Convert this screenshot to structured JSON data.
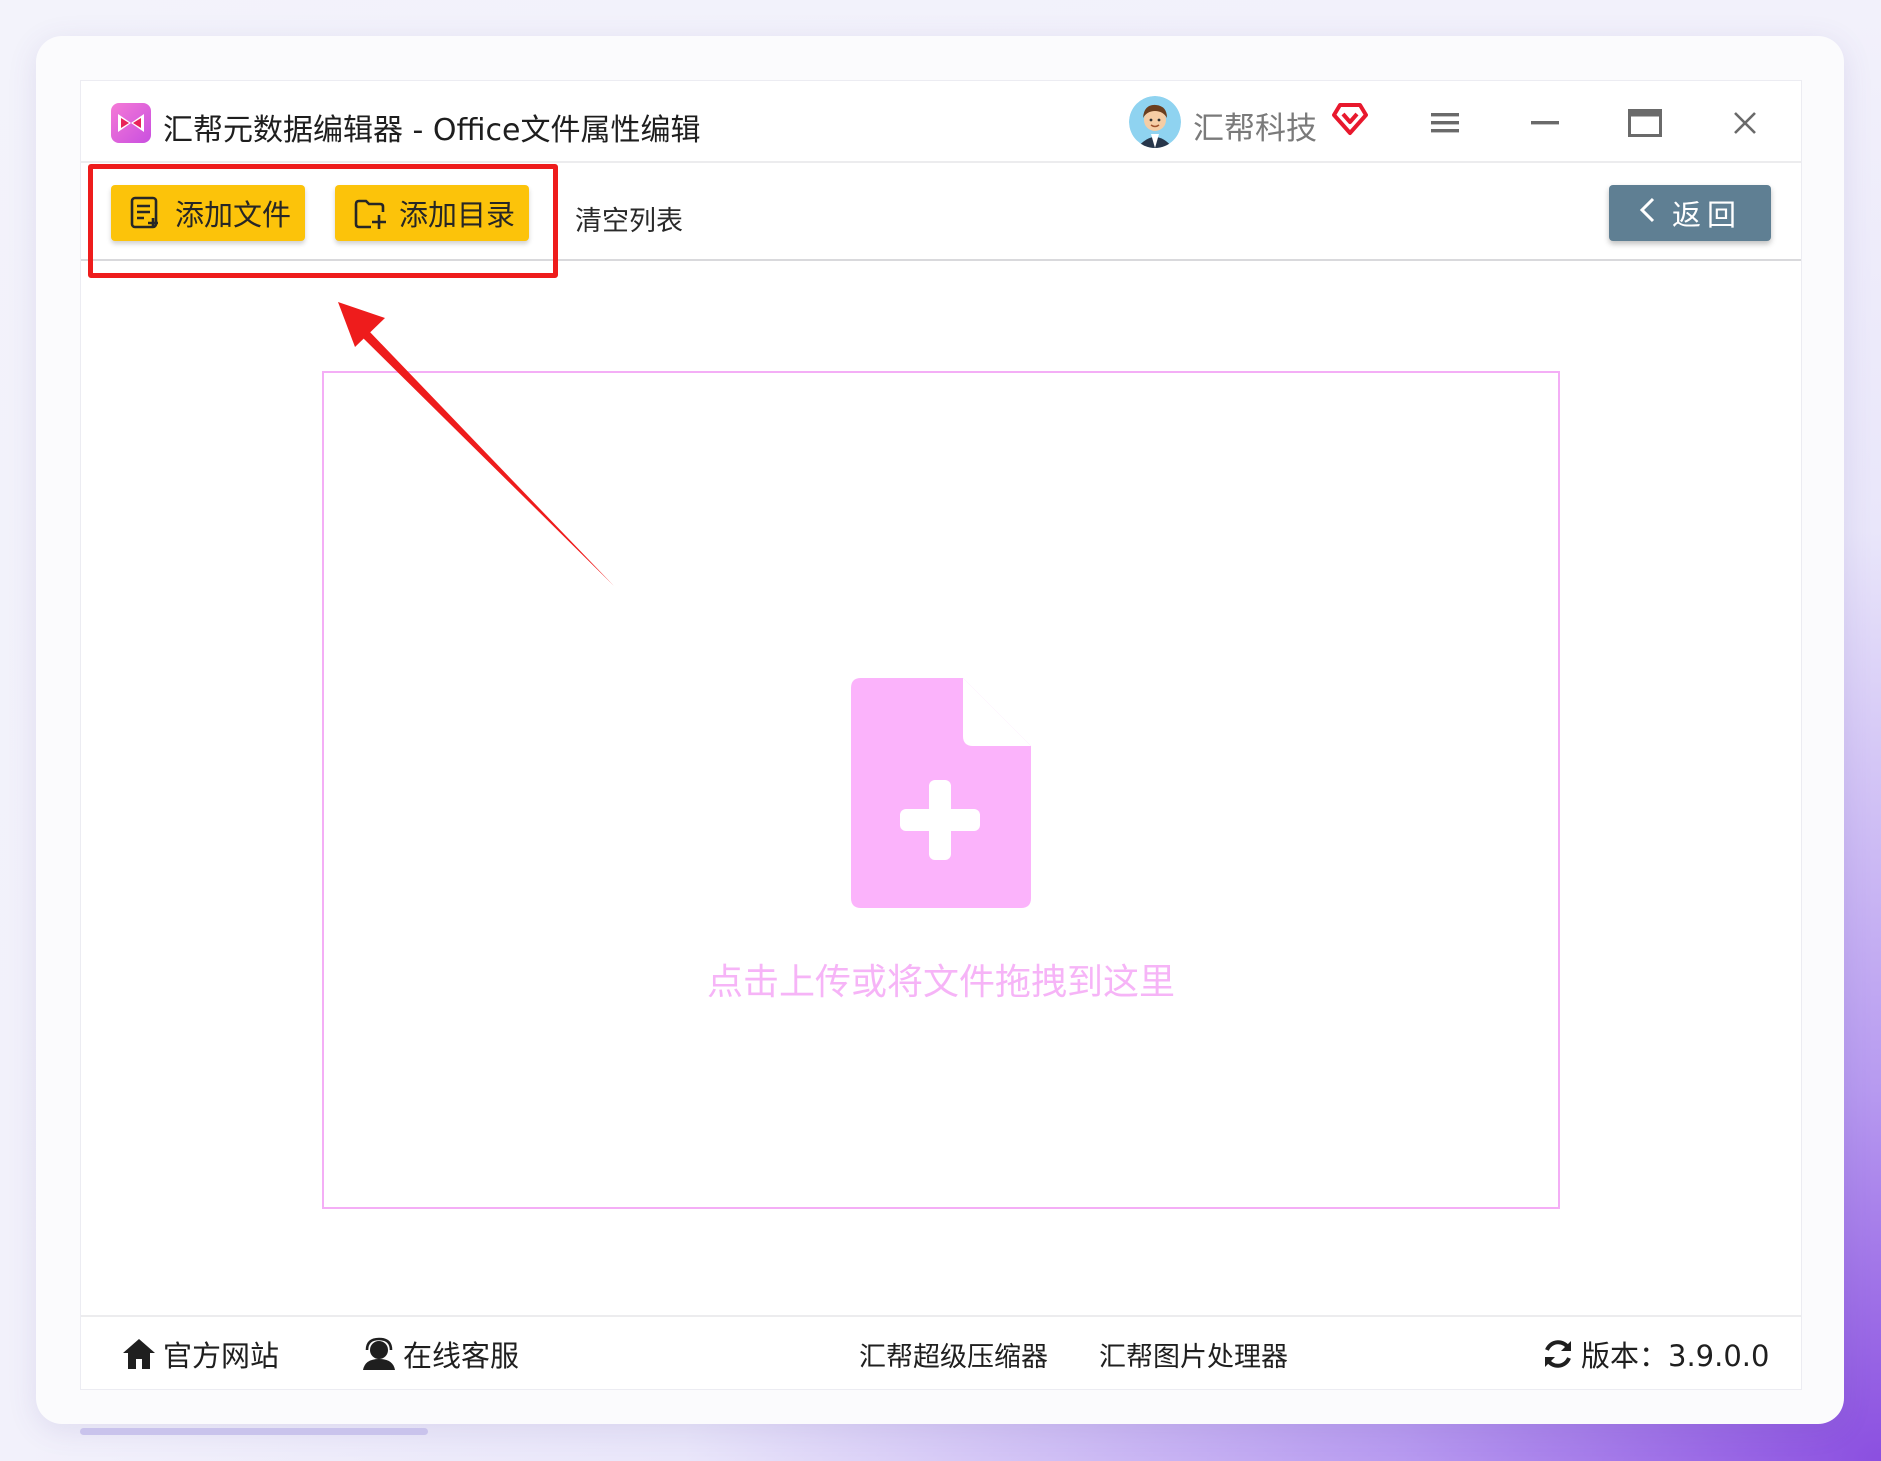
{
  "titlebar": {
    "title": "汇帮元数据编辑器 - Office文件属性编辑",
    "user_name": "汇帮科技",
    "icons": [
      "app-logo-icon",
      "avatar",
      "vip-heart-icon",
      "menu-icon",
      "minimize-icon",
      "maximize-icon",
      "close-icon"
    ]
  },
  "toolbar": {
    "add_file_label": "添加文件",
    "add_dir_label": "添加目录",
    "clear_list_label": "清空列表",
    "back_label": "返回"
  },
  "dropzone": {
    "hint": "点击上传或将文件拖拽到这里"
  },
  "footer": {
    "site_label": "官方网站",
    "service_label": "在线客服",
    "compressor_label": "汇帮超级压缩器",
    "image_tool_label": "汇帮图片处理器",
    "version_label": "版本：3.9.0.0"
  },
  "colors": {
    "accent_yellow": "#fcc30a",
    "back_button": "#5f7f93",
    "dropzone_pink": "#f4aef6",
    "highlight_red": "#ee1c1c"
  }
}
